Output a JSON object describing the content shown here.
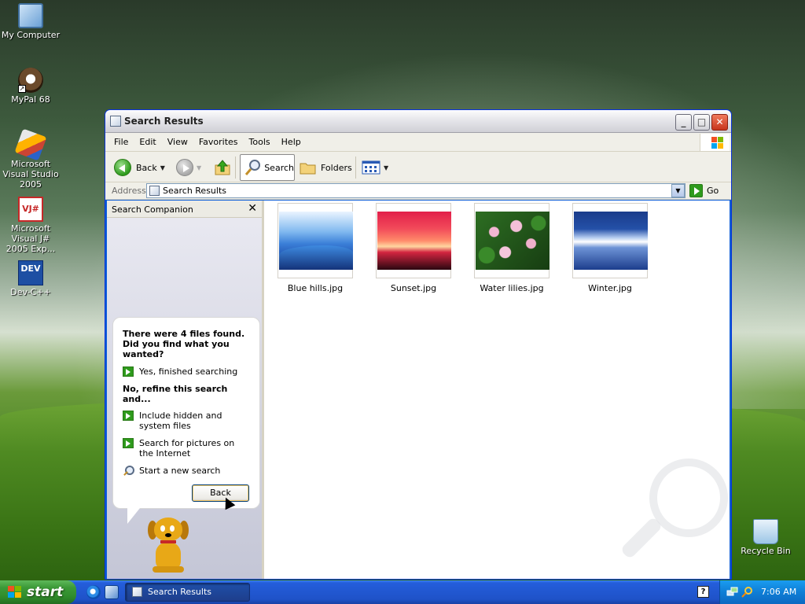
{
  "desktop": {
    "icons": [
      {
        "label": "My Computer",
        "icon": "my-computer-icon"
      },
      {
        "label": "MyPal 68",
        "icon": "mypal-icon"
      },
      {
        "label": "Microsoft Visual Studio 2005",
        "icon": "visual-studio-icon"
      },
      {
        "label": "Microsoft Visual J# 2005 Exp...",
        "icon": "visual-j-sharp-icon"
      },
      {
        "label": "Dev-C++",
        "icon": "dev-cpp-icon"
      },
      {
        "label": "Recycle Bin",
        "icon": "recycle-bin-icon"
      }
    ],
    "vj_glyph": "VJ#",
    "dev_glyph": "DEV"
  },
  "window": {
    "title": "Search Results",
    "controls": {
      "minimize": "_",
      "maximize": "□",
      "close": "✕"
    },
    "menu": [
      "File",
      "Edit",
      "View",
      "Favorites",
      "Tools",
      "Help"
    ],
    "toolbar": {
      "back": "Back",
      "search": "Search",
      "folders": "Folders"
    },
    "address": {
      "label": "Address",
      "value": "Search Results",
      "go": "Go"
    }
  },
  "companion": {
    "title": "Search Companion",
    "close": "✕",
    "message": "There were 4 files found. Did you find what you wanted?",
    "yes_link": "Yes, finished searching",
    "refine_heading": "No, refine this search and...",
    "refine_links": [
      "Include hidden and system files",
      "Search for pictures on the Internet"
    ],
    "new_search": "Start a new search",
    "back_button": "Back"
  },
  "files": [
    {
      "name": "Blue hills.jpg"
    },
    {
      "name": "Sunset.jpg"
    },
    {
      "name": "Water lilies.jpg"
    },
    {
      "name": "Winter.jpg"
    }
  ],
  "taskbar": {
    "start": "start",
    "task": "Search Results",
    "help": "?",
    "clock": "7:06 AM"
  },
  "colors": {
    "xp_blue": "#0b5cd7",
    "start_green": "#3c9a38",
    "tray_blue": "#0f7ed6"
  }
}
